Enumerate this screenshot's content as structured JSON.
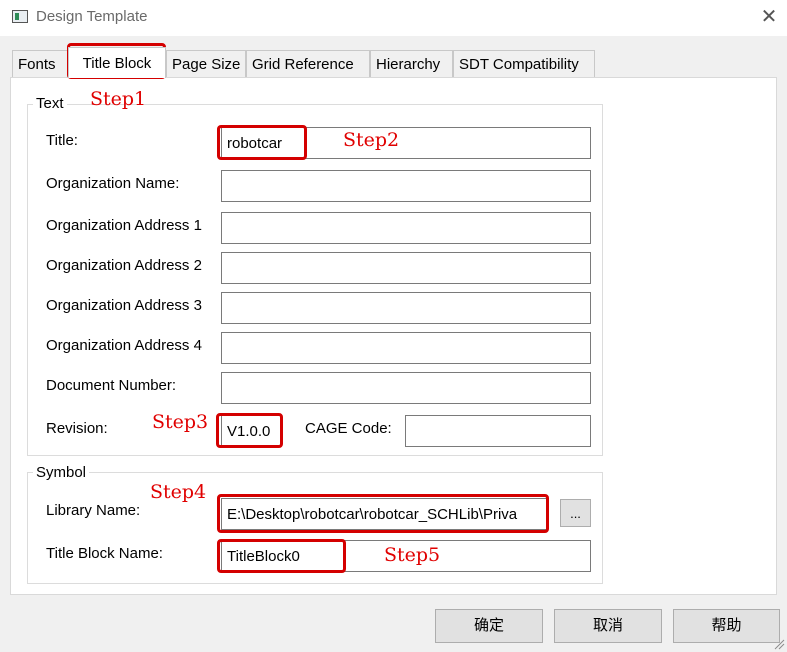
{
  "window": {
    "title": "Design Template",
    "close_glyph": "✕"
  },
  "tabs": [
    {
      "label": "Fonts"
    },
    {
      "label": "Title Block"
    },
    {
      "label": "Page Size"
    },
    {
      "label": "Grid Reference"
    },
    {
      "label": "Hierarchy"
    },
    {
      "label": "SDT Compatibility"
    }
  ],
  "text_group": {
    "label": "Text",
    "title_label": "Title:",
    "title_value": "robotcar",
    "org_name_label": "Organization Name:",
    "org_name_value": "",
    "org_addr_1_label": "Organization Address 1",
    "org_addr_1_value": "",
    "org_addr_2_label": "Organization Address 2",
    "org_addr_2_value": "",
    "org_addr_3_label": "Organization Address 3",
    "org_addr_3_value": "",
    "org_addr_4_label": "Organization Address 4",
    "org_addr_4_value": "",
    "doc_number_label": "Document Number:",
    "doc_number_value": "",
    "revision_label": "Revision:",
    "revision_value": "V1.0.0",
    "cage_label": "CAGE Code:",
    "cage_value": ""
  },
  "symbol_group": {
    "label": "Symbol",
    "library_label": "Library Name:",
    "library_value": "E:\\Desktop\\robotcar\\robotcar_SCHLib\\Priva",
    "browse_label": "...",
    "title_block_label": "Title Block Name:",
    "title_block_value": "TitleBlock0"
  },
  "annotations": {
    "step1": "Step1",
    "step2": "Step2",
    "step3": "Step3",
    "step4": "Step4",
    "step5": "Step5",
    "color": "#d40000"
  },
  "buttons": {
    "ok": "确定",
    "cancel": "取消",
    "help": "帮助"
  }
}
